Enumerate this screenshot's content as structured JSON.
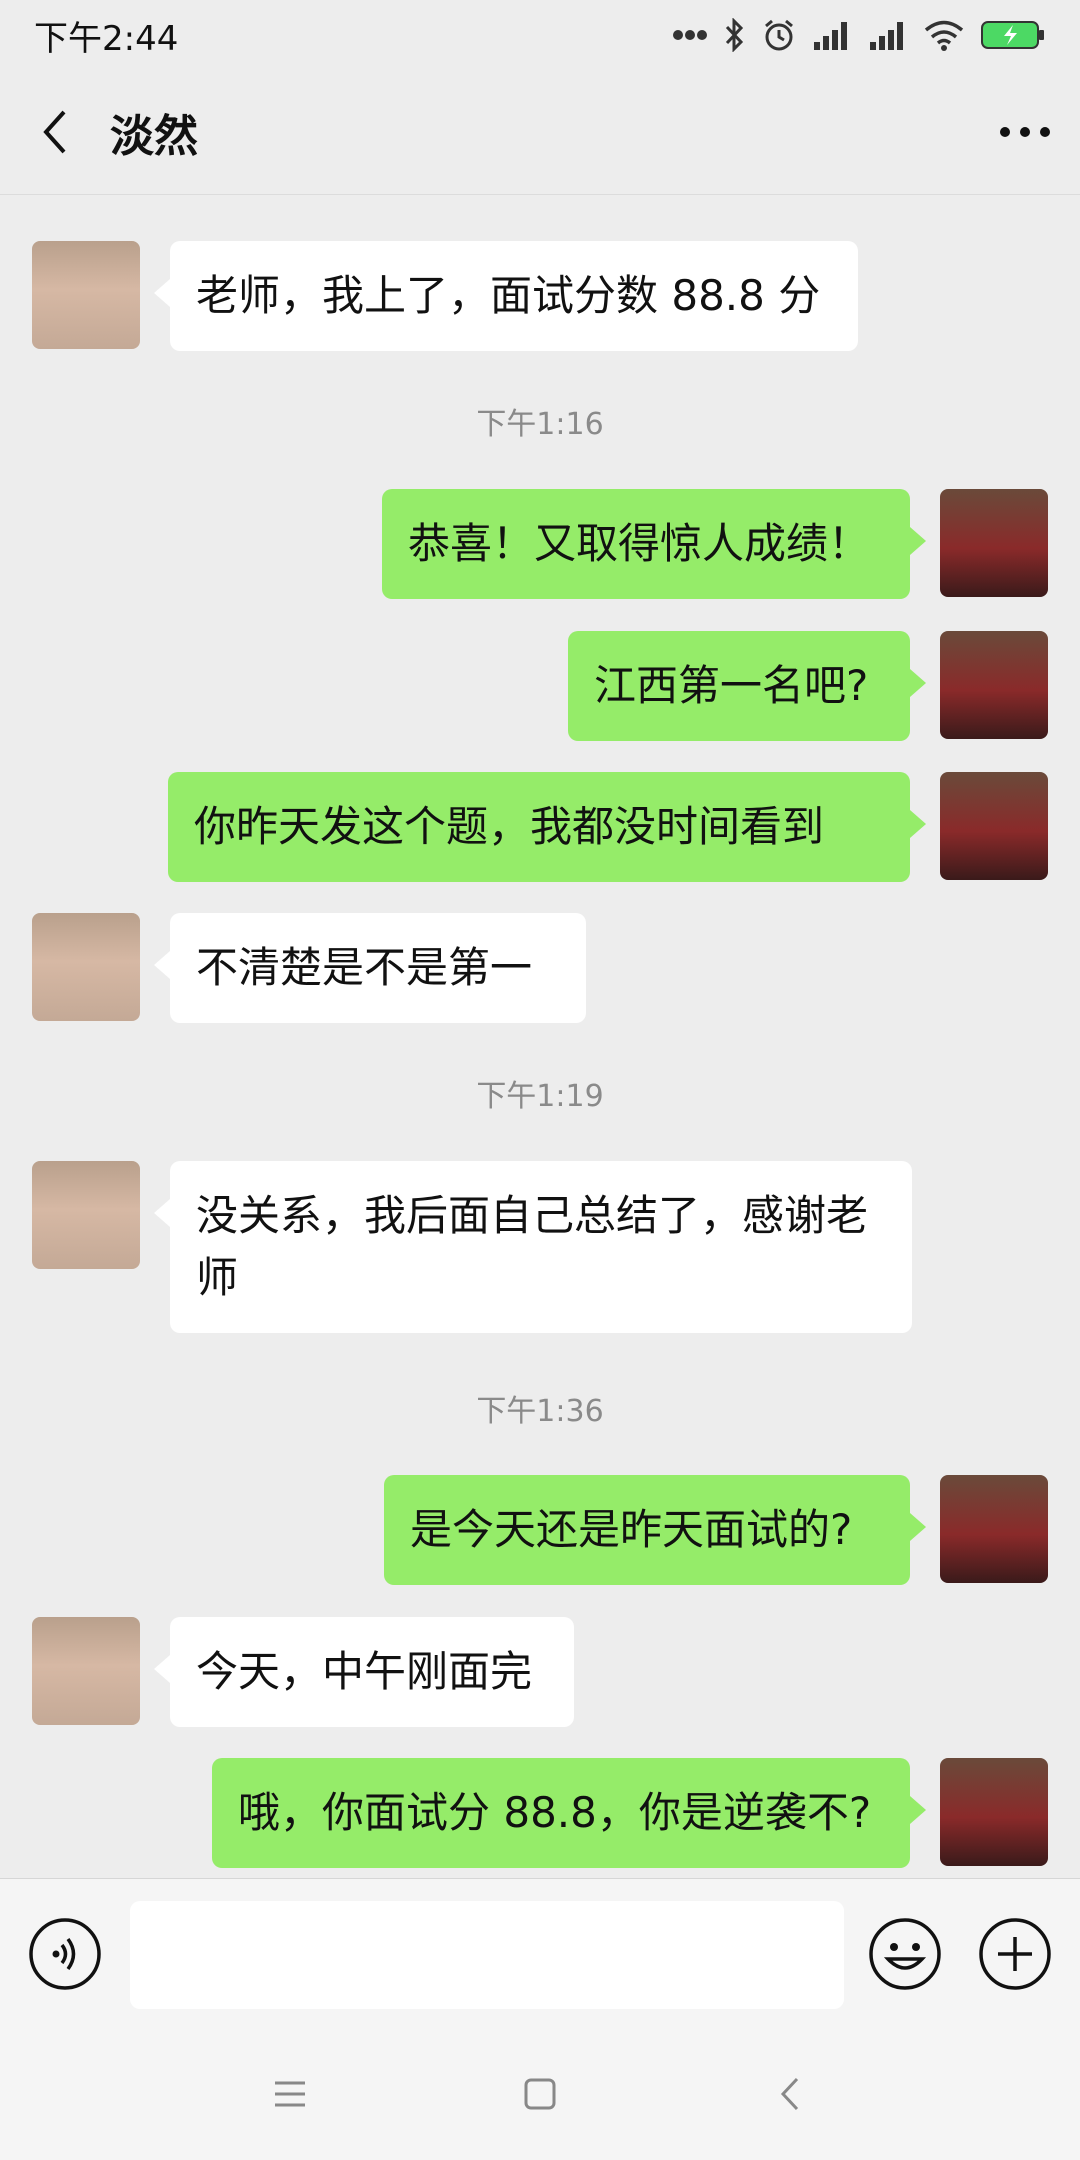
{
  "status_bar": {
    "time": "下午2:44"
  },
  "header": {
    "title": "淡然"
  },
  "messages": [
    {
      "text": "老师，我上了，面试分数 88.8 分"
    },
    {
      "timestamp": "下午1:16"
    },
    {
      "text": "恭喜！又取得惊人成绩！"
    },
    {
      "text": "江西第一名吧?"
    },
    {
      "text": "你昨天发这个题，我都没时间看到"
    },
    {
      "text": "不清楚是不是第一"
    },
    {
      "timestamp": "下午1:19"
    },
    {
      "text": "没关系，我后面自己总结了，感谢老师"
    },
    {
      "timestamp": "下午1:36"
    },
    {
      "text": "是今天还是昨天面试的?"
    },
    {
      "text": "今天，中午刚面完"
    },
    {
      "text": "哦，你面试分 88.8，你是逆袭不?"
    }
  ],
  "colors": {
    "background": "#ededed",
    "bubble_out": "#95ec69",
    "bubble_in": "#ffffff",
    "timestamp": "#8a8a8a"
  },
  "icons": {
    "back": "back-arrow-icon",
    "more": "more-dots-icon",
    "voice": "voice-icon",
    "emoji": "emoji-icon",
    "plus": "plus-icon"
  }
}
